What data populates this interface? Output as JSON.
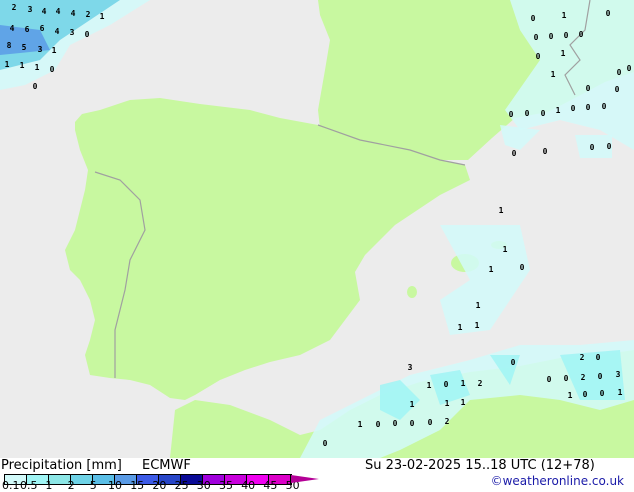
{
  "title": "Precipitation [mm]",
  "model": "ECMWF",
  "valid_time": "Su 23-02-2025 15..18 UTC (12+78)",
  "credit": "©weatheronline.co.uk",
  "colors": {
    "sea": "#ececec",
    "land": "#c8f8a0",
    "border": "#a0a0a0"
  },
  "legend": {
    "ticks": [
      "0.1",
      "0.5",
      "1",
      "2",
      "5",
      "10",
      "15",
      "20",
      "25",
      "30",
      "35",
      "40",
      "45",
      "50"
    ],
    "colors": [
      "#d2fafa",
      "#a0f5f5",
      "#8ce6e6",
      "#6ed2e6",
      "#5abee6",
      "#5a9be6",
      "#3c5ae6",
      "#2846c8",
      "#0a0a96",
      "#a000dc",
      "#c800dc",
      "#f000f0",
      "#dc00c8",
      "#b40096"
    ]
  },
  "precip_labels": [
    "2",
    "3",
    "4",
    "4",
    "4",
    "2",
    "1",
    "4",
    "6",
    "6",
    "4",
    "3",
    "0",
    "8",
    "5",
    "3",
    "1",
    "1",
    "1",
    "1",
    "0",
    "0",
    "0",
    "1",
    "0",
    "0",
    "0",
    "0",
    "0",
    "0",
    "1",
    "0",
    "0",
    "1",
    "0",
    "0",
    "0",
    "0",
    "0",
    "1",
    "0",
    "0",
    "0",
    "0",
    "0",
    "0",
    "0",
    "1",
    "1",
    "1",
    "0",
    "1",
    "1",
    "1",
    "3",
    "1",
    "0",
    "1",
    "2",
    "0",
    "0",
    "0",
    "2",
    "0",
    "3",
    "1",
    "0",
    "0",
    "1",
    "2",
    "0",
    "1",
    "1",
    "1",
    "1",
    "0",
    "0",
    "0",
    "0",
    "2",
    "0",
    "0"
  ]
}
